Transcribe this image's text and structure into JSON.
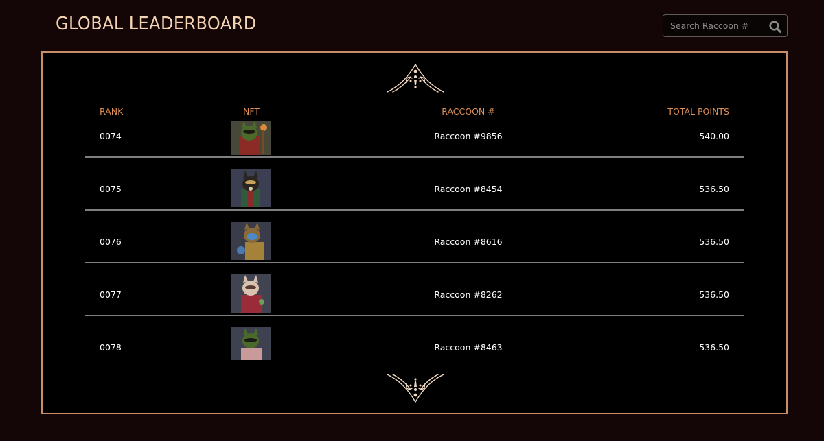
{
  "header": {
    "title": "GLOBAL LEADERBOARD",
    "search_placeholder": "Search Raccoon #"
  },
  "table": {
    "columns": {
      "rank": "RANK",
      "nft": "NFT",
      "raccoon": "RACCOON #",
      "points": "TOTAL POINTS"
    },
    "rows": [
      {
        "rank": "0074",
        "name": "Raccoon #9856",
        "points": "540.00"
      },
      {
        "rank": "0075",
        "name": "Raccoon #8454",
        "points": "536.50"
      },
      {
        "rank": "0076",
        "name": "Raccoon #8616",
        "points": "536.50"
      },
      {
        "rank": "0077",
        "name": "Raccoon #8262",
        "points": "536.50"
      },
      {
        "rank": "0078",
        "name": "Raccoon #8463",
        "points": "536.50"
      }
    ]
  },
  "colors": {
    "background": "#140606",
    "title": "#f3d3b1",
    "accent_border": "#c88e67",
    "column_header": "#de8f55",
    "divider": "#7f7f7f"
  },
  "icons": {
    "search": "search-icon",
    "ornament": "ornament-icon"
  }
}
